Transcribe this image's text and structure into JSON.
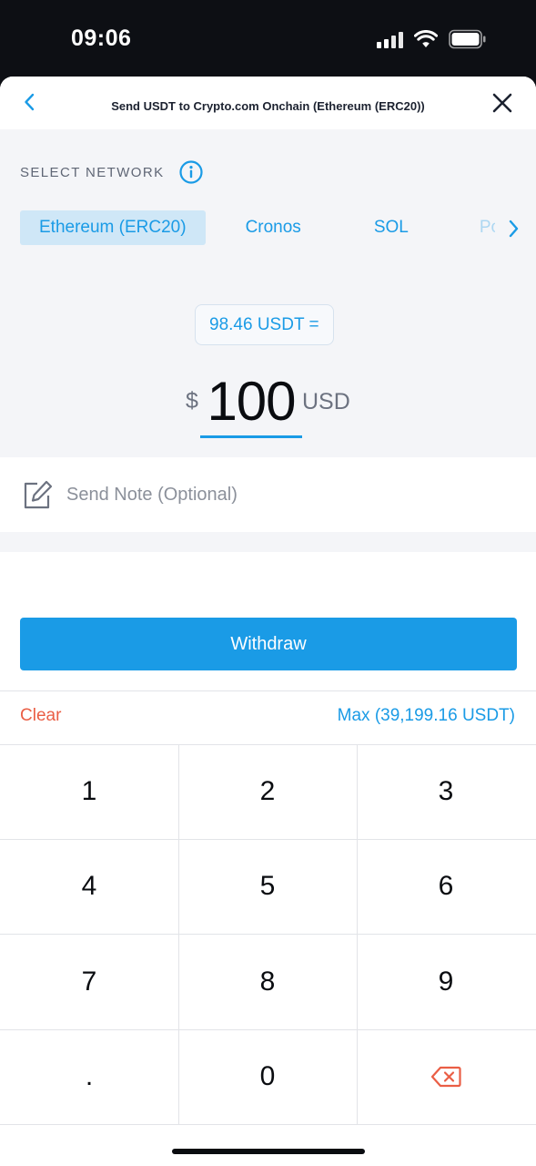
{
  "status_bar": {
    "time": "09:06",
    "icons": [
      "cellular-signal-icon",
      "wifi-icon",
      "battery-icon"
    ]
  },
  "header": {
    "back_icon": "chevron-left-icon",
    "title": "Send USDT to Crypto.com Onchain (Ethereum (ERC20))",
    "close_icon": "close-icon"
  },
  "network": {
    "label": "SELECT NETWORK",
    "info_icon": "info-icon",
    "tabs": [
      {
        "label": "Ethereum (ERC20)",
        "selected": true
      },
      {
        "label": "Cronos",
        "selected": false
      },
      {
        "label": "SOL",
        "selected": false
      },
      {
        "label": "Po",
        "selected": false
      }
    ],
    "next_icon": "chevron-right-icon"
  },
  "amount": {
    "conversion": "98.46 USDT =",
    "currency_symbol": "$",
    "value": "100",
    "currency_code": "USD"
  },
  "note": {
    "icon": "edit-note-icon",
    "placeholder": "Send Note (Optional)"
  },
  "actions": {
    "withdraw_label": "Withdraw",
    "clear_label": "Clear",
    "max_label": "Max (39,199.16 USDT)"
  },
  "keypad": {
    "keys": [
      "1",
      "2",
      "3",
      "4",
      "5",
      "6",
      "7",
      "8",
      "9",
      ".",
      "0"
    ],
    "backspace_icon": "backspace-icon"
  },
  "colors": {
    "accent": "#1a9be6",
    "clear": "#ea5e45",
    "selected_tab_bg": "#cfe7f7",
    "panel_bg": "#f4f5f8"
  }
}
